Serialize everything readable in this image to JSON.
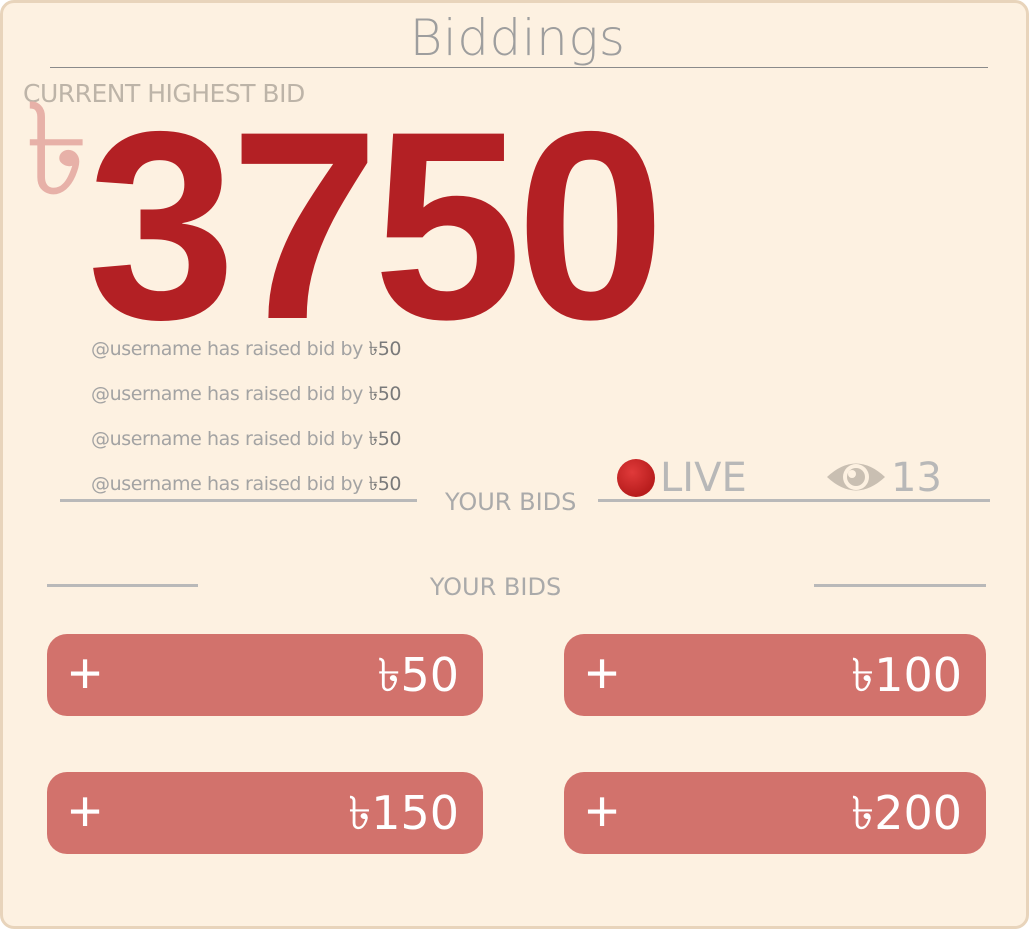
{
  "header": {
    "title": "Biddings"
  },
  "current_bid": {
    "label": "CURRENT HIGHEST BID",
    "currency_symbol": "৳",
    "amount": "3750"
  },
  "feed": [
    {
      "text": "@username has raised bid by ",
      "amount": "৳50"
    },
    {
      "text": "@username has raised bid by ",
      "amount": "৳50"
    },
    {
      "text": "@username has raised bid by ",
      "amount": "৳50"
    },
    {
      "text": "@username has raised bid by ",
      "amount": "৳50"
    }
  ],
  "status": {
    "your_bids_label": "YOUR BIDS",
    "live_label": "LIVE",
    "viewer_count": "13",
    "icons": [
      "live-dot",
      "eye-icon"
    ]
  },
  "bids_section": {
    "label": "YOUR BIDS",
    "buttons": [
      {
        "plus": "+",
        "amount": "৳50"
      },
      {
        "plus": "+",
        "amount": "৳100"
      },
      {
        "plus": "+",
        "amount": "৳150"
      },
      {
        "plus": "+",
        "amount": "৳200"
      }
    ]
  },
  "colors": {
    "background": "#fdf1e1",
    "accent": "#b32024",
    "button": "#d2726c",
    "live": "#c42222"
  }
}
